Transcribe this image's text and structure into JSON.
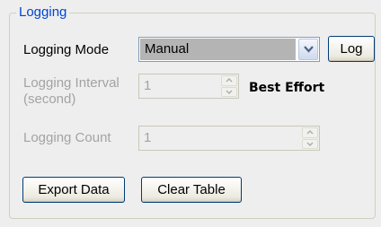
{
  "group": {
    "title": "Logging"
  },
  "mode": {
    "label": "Logging Mode",
    "value": "Manual",
    "log_button": "Log"
  },
  "interval": {
    "label_line1": "Logging Interval",
    "label_line2": "(second)",
    "value": "1",
    "note": "Best Effort"
  },
  "count": {
    "label": "Logging Count",
    "value": "1"
  },
  "actions": {
    "export": "Export Data",
    "clear": "Clear Table"
  },
  "colors": {
    "legend": "#0046d5",
    "disabled_text": "#a3a3a3",
    "button_border": "#003c74"
  },
  "icons": {
    "dropdown": "chevron-down-icon",
    "spin_up": "spin-up-icon",
    "spin_down": "spin-down-icon"
  }
}
